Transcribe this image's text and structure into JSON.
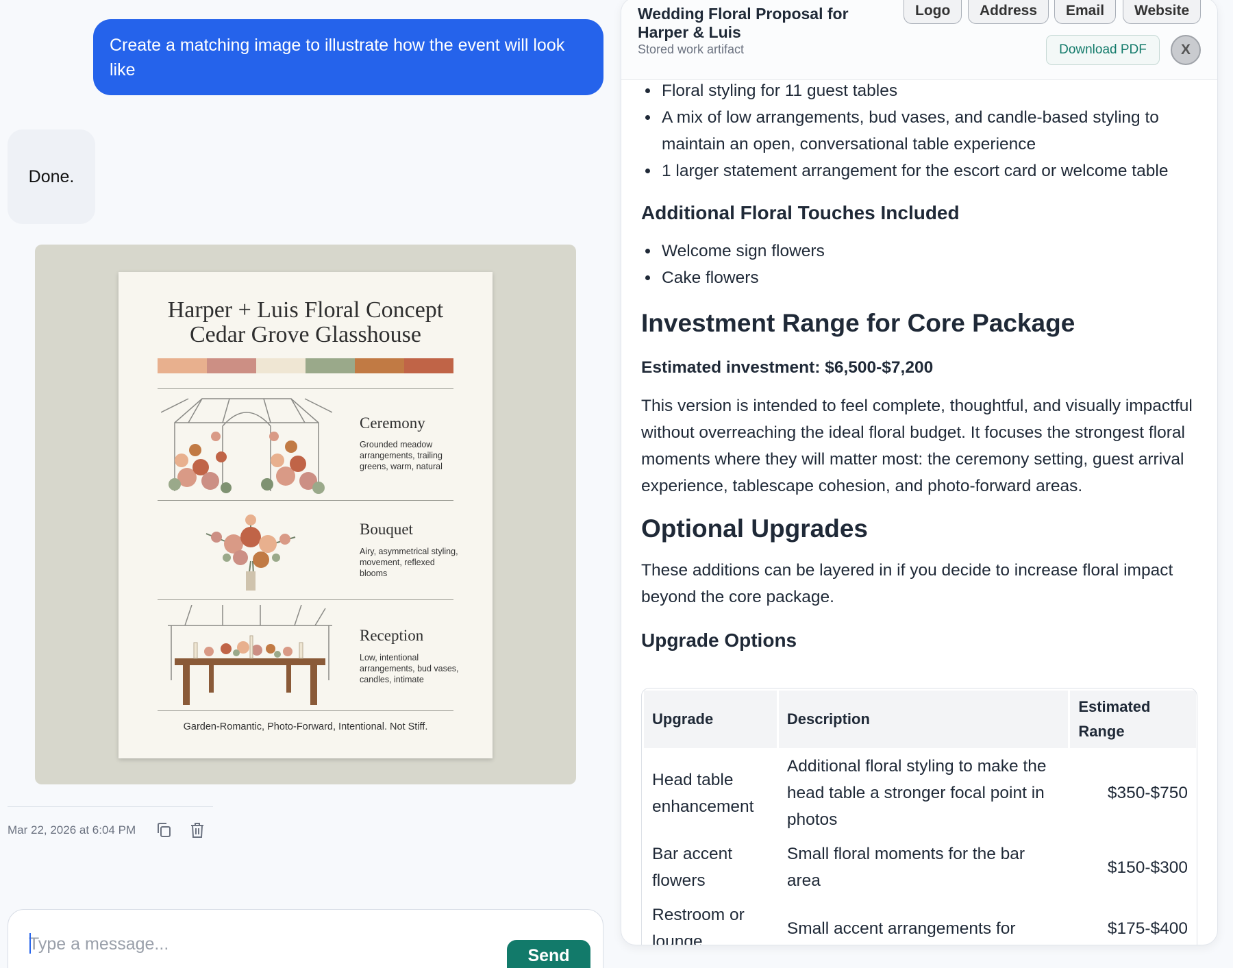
{
  "chat": {
    "user_message": "Create a matching image to illustrate how the event will look like",
    "bot_message": "Done.",
    "timestamp": "Mar 22, 2026 at 6:04 PM",
    "composer_placeholder": "Type a message...",
    "send_label": "Send"
  },
  "poster": {
    "title_line1": "Harper + Luis Floral Concept",
    "title_line2": "Cedar Grove Glasshouse",
    "palette": [
      "#e8b08e",
      "#cc8f84",
      "#efe6d3",
      "#9aa98a",
      "#c17a44",
      "#c06447"
    ],
    "sections": [
      {
        "title": "Ceremony",
        "desc": "Grounded meadow arrangements, trailing greens, warm, natural"
      },
      {
        "title": "Bouquet",
        "desc": "Airy, asymmetrical styling, movement, reflexed blooms"
      },
      {
        "title": "Reception",
        "desc": "Low, intentional arrangements, bud vases, candles, intimate"
      }
    ],
    "footer": "Garden-Romantic, Photo-Forward, Intentional. Not Stiff."
  },
  "artifact": {
    "title": "Wedding Floral Proposal for Harper & Luis",
    "subtitle": "Stored work artifact",
    "chips": [
      "Logo",
      "Address",
      "Email",
      "Website"
    ],
    "download_label": "Download PDF",
    "close_label": "X",
    "table_bullets": [
      "Floral styling for 11 guest tables",
      "A mix of low arrangements, bud vases, and candle-based styling to maintain an open, conversational table experience",
      "1 larger statement arrangement for the escort card or welcome table"
    ],
    "touches_heading": "Additional Floral Touches Included",
    "touches": [
      "Welcome sign flowers",
      "Cake flowers"
    ],
    "investment_heading": "Investment Range for Core Package",
    "investment_line": "Estimated investment: $6,500-$7,200",
    "investment_para": "This version is intended to feel complete, thoughtful, and visually impactful without overreaching the ideal floral budget. It focuses the strongest floral moments where they will matter most: the ceremony setting, guest arrival experience, tablescape cohesion, and photo-forward areas.",
    "upgrades_heading": "Optional Upgrades",
    "upgrades_para": "These additions can be layered in if you decide to increase floral impact beyond the core package.",
    "upgrade_options_heading": "Upgrade Options",
    "table": {
      "headers": [
        "Upgrade",
        "Description",
        "Estimated Range"
      ],
      "rows": [
        [
          "Head table enhancement",
          "Additional floral styling to make the head table a stronger focal point in photos",
          "$350-$750"
        ],
        [
          "Bar accent flowers",
          "Small floral moments for the bar area",
          "$150-$300"
        ],
        [
          "Restroom or lounge",
          "Small accent arrangements for",
          "$175-$400"
        ]
      ]
    }
  }
}
